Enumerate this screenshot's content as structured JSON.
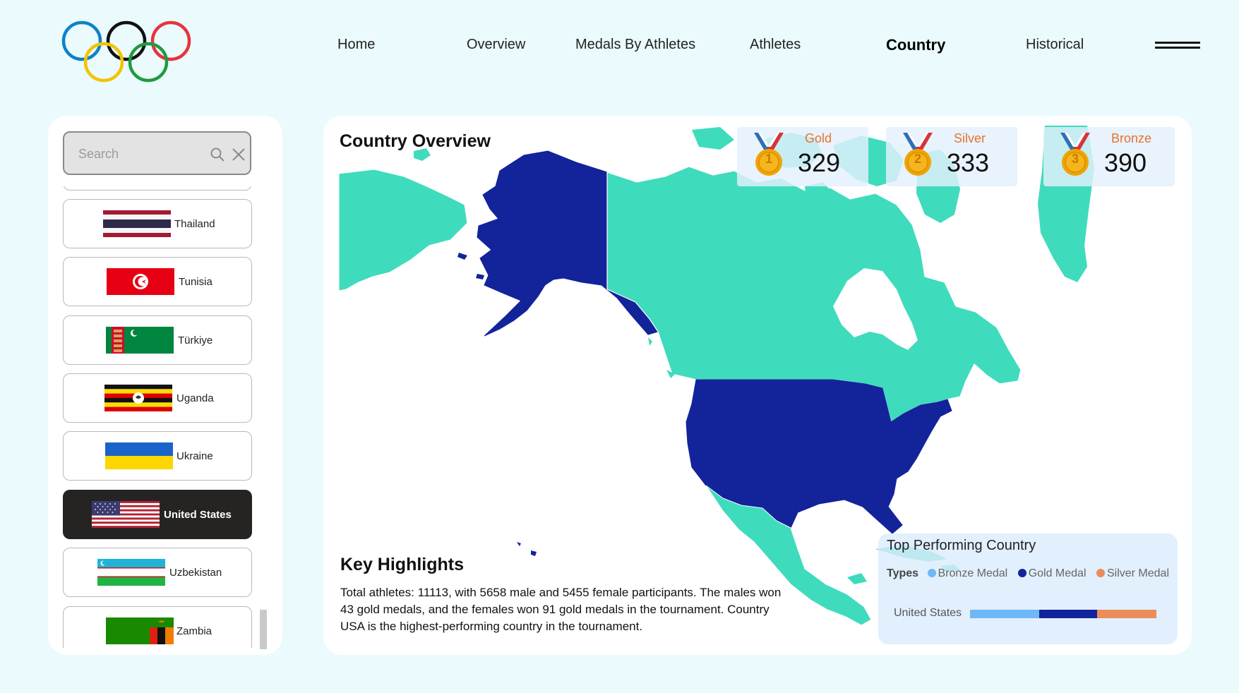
{
  "nav": {
    "items": [
      "Home",
      "Overview",
      "Medals By Athletes",
      "Athletes",
      "Country",
      "Historical"
    ],
    "active": "Country"
  },
  "search": {
    "placeholder": "Search"
  },
  "countries": [
    {
      "name": "Thailand",
      "selected": false
    },
    {
      "name": "Tunisia",
      "selected": false
    },
    {
      "name": "Türkiye",
      "selected": false
    },
    {
      "name": "Uganda",
      "selected": false
    },
    {
      "name": "Ukraine",
      "selected": false
    },
    {
      "name": "United States",
      "selected": true
    },
    {
      "name": "Uzbekistan",
      "selected": false
    },
    {
      "name": "Zambia",
      "selected": false
    }
  ],
  "overview": {
    "title": "Country Overview"
  },
  "medals": {
    "gold": {
      "label": "Gold",
      "value": "329",
      "number": "1"
    },
    "silver": {
      "label": "Silver",
      "value": "333",
      "number": "2"
    },
    "bronze": {
      "label": "Bronze",
      "value": "390",
      "number": "3"
    }
  },
  "highlights": {
    "title": "Key Highlights",
    "text": "Total athletes: 11113, with 5658 male and 5455 female participants. The males won 43 gold medals, and the females won 91 gold medals in the tournament. Country USA is the highest-performing country in the tournament."
  },
  "top_performing": {
    "title": "Top Performing Country",
    "legend_title": "Types",
    "legend": [
      {
        "label": "Bronze Medal",
        "color": "#6fb8f5"
      },
      {
        "label": "Gold Medal",
        "color": "#13239a"
      },
      {
        "label": "Silver Medal",
        "color": "#ec8c5b"
      }
    ],
    "country": "United States"
  },
  "colors": {
    "page_bg": "#eafafd",
    "highlight_country": "#13239a",
    "other_land": "#3fdbbd",
    "accent_orange": "#e8732c"
  },
  "chart_data": {
    "type": "bar",
    "orientation": "horizontal-stacked",
    "title": "Top Performing Country",
    "categories": [
      "United States"
    ],
    "series": [
      {
        "name": "Bronze Medal",
        "values": [
          390
        ]
      },
      {
        "name": "Gold Medal",
        "values": [
          329
        ]
      },
      {
        "name": "Silver Medal",
        "values": [
          333
        ]
      }
    ]
  }
}
